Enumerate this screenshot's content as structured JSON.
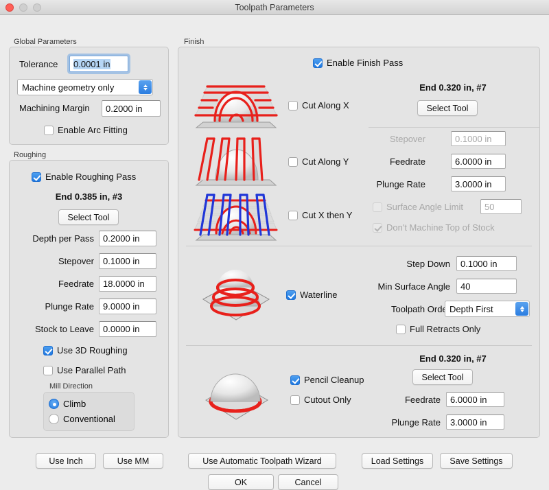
{
  "window": {
    "title": "Toolpath Parameters",
    "traffic_lights": [
      "close-button",
      "minimize-button",
      "maximize-button"
    ]
  },
  "global": {
    "group_label": "Global Parameters",
    "tolerance_label": "Tolerance",
    "tolerance_value": "0.0001 in",
    "geometry_mode": "Machine geometry only",
    "margin_label": "Machining Margin",
    "margin_value": "0.2000 in",
    "arc_fitting_label": "Enable Arc Fitting",
    "arc_fitting_checked": false
  },
  "roughing": {
    "group_label": "Roughing",
    "enable_label": "Enable Roughing Pass",
    "enable_checked": true,
    "tool_text": "End 0.385 in, #3",
    "select_tool_label": "Select Tool",
    "rows": [
      {
        "label": "Depth per Pass",
        "value": "0.2000 in"
      },
      {
        "label": "Stepover",
        "value": "0.1000 in"
      },
      {
        "label": "Feedrate",
        "value": "18.0000 in"
      },
      {
        "label": "Plunge Rate",
        "value": "9.0000 in"
      },
      {
        "label": "Stock to Leave",
        "value": "0.0000 in"
      }
    ],
    "use_3d_label": "Use 3D Roughing",
    "use_3d_checked": true,
    "parallel_label": "Use Parallel Path",
    "parallel_checked": false,
    "mill_direction_label": "Mill Direction",
    "mill_options": [
      "Climb",
      "Conventional"
    ],
    "mill_selected": "Climb"
  },
  "finish": {
    "group_label": "Finish",
    "enable_label": "Enable Finish Pass",
    "enable_checked": true,
    "cut_x_label": "Cut Along X",
    "cut_x_checked": false,
    "cut_y_label": "Cut Along Y",
    "cut_y_checked": false,
    "cut_xy_label": "Cut X then Y",
    "cut_xy_checked": false,
    "tool_text": "End 0.320 in, #7",
    "select_tool_label": "Select Tool",
    "stepover_label": "Stepover",
    "stepover_value": "0.1000 in",
    "feedrate_label": "Feedrate",
    "feedrate_value": "6.0000 in",
    "plunge_label": "Plunge Rate",
    "plunge_value": "3.0000 in",
    "surface_angle_label": "Surface Angle Limit",
    "surface_angle_checked": false,
    "surface_angle_value": "50",
    "no_top_label": "Don't Machine Top of Stock",
    "no_top_checked": true
  },
  "waterline": {
    "enable_label": "Waterline",
    "enable_checked": true,
    "step_down_label": "Step Down",
    "step_down_value": "0.1000 in",
    "min_angle_label": "Min Surface Angle",
    "min_angle_value": "40",
    "order_label": "Toolpath Order",
    "order_value": "Depth First",
    "full_retracts_label": "Full Retracts Only",
    "full_retracts_checked": false
  },
  "pencil": {
    "tool_text": "End 0.320 in, #7",
    "select_tool_label": "Select Tool",
    "cleanup_label": "Pencil Cleanup",
    "cleanup_checked": true,
    "cutout_label": "Cutout Only",
    "cutout_checked": false,
    "feedrate_label": "Feedrate",
    "feedrate_value": "6.0000 in",
    "plunge_label": "Plunge Rate",
    "plunge_value": "3.0000 in"
  },
  "footer": {
    "use_inch": "Use Inch",
    "use_mm": "Use MM",
    "wizard": "Use Automatic Toolpath Wizard",
    "load_settings": "Load Settings",
    "save_settings": "Save Settings",
    "ok": "OK",
    "cancel": "Cancel"
  },
  "colors": {
    "accent": "#2b7de0",
    "toolpath_red": "#e8201b",
    "toolpath_blue": "#2036d8",
    "window_bg": "#ececec",
    "panel_bg": "#e4e4e4"
  }
}
